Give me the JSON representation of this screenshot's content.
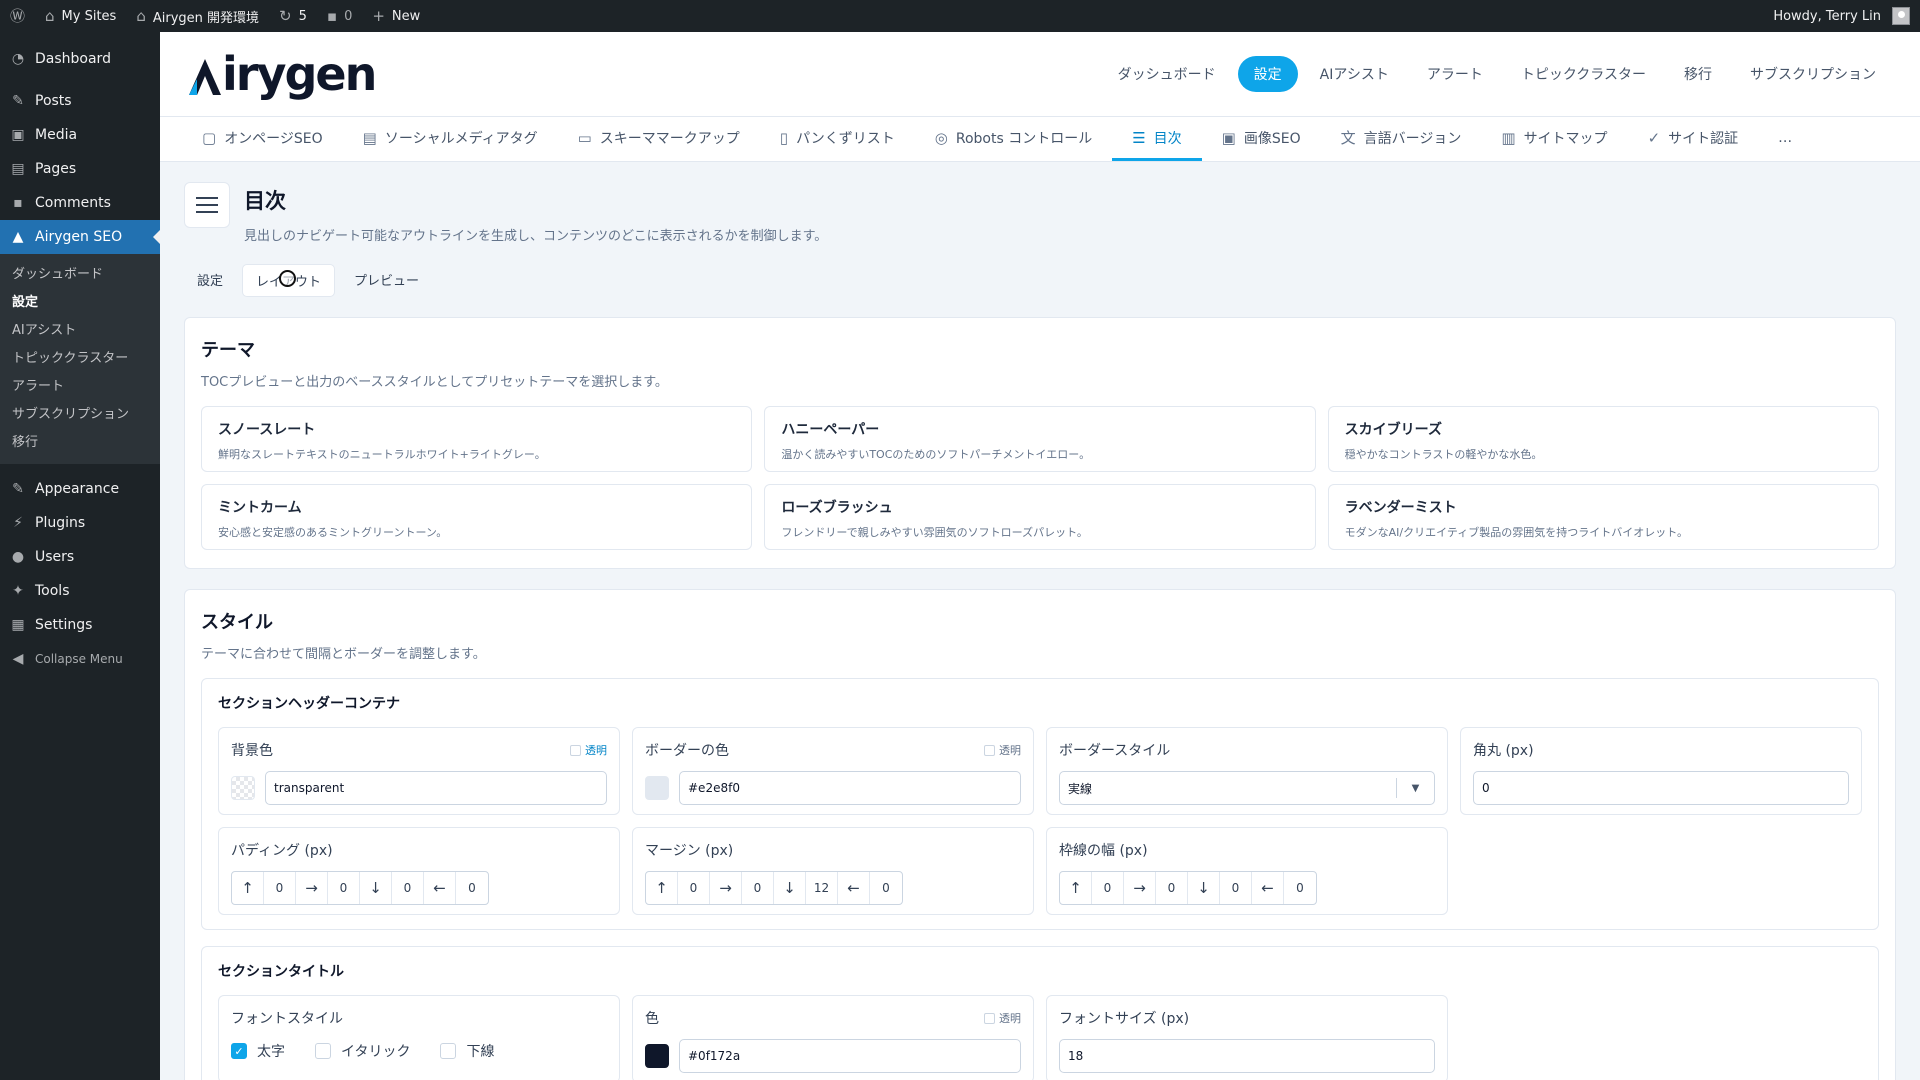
{
  "adminbar": {
    "my_sites": "My Sites",
    "site_name": "Airygen 開発環境",
    "updates_count": "5",
    "comments_count": "0",
    "new_label": "New",
    "howdy": "Howdy, Terry Lin"
  },
  "adminmenu": {
    "dashboard": "Dashboard",
    "posts": "Posts",
    "media": "Media",
    "pages": "Pages",
    "comments": "Comments",
    "airygen": "Airygen SEO",
    "submenu": [
      "ダッシュボード",
      "設定",
      "AIアシスト",
      "トピッククラスター",
      "アラート",
      "サブスクリプション",
      "移行"
    ],
    "appearance": "Appearance",
    "plugins": "Plugins",
    "users": "Users",
    "tools": "Tools",
    "settings": "Settings",
    "collapse": "Collapse Menu"
  },
  "plugin_header": {
    "logo": "irygen",
    "nav": [
      "ダッシュボード",
      "設定",
      "AIアシスト",
      "アラート",
      "トピッククラスター",
      "移行",
      "サブスクリプション"
    ]
  },
  "tabs": [
    "オンページSEO",
    "ソーシャルメディアタグ",
    "スキーママークアップ",
    "パンくずリスト",
    "Robots コントロール",
    "目次",
    "画像SEO",
    "言語バージョン",
    "サイトマップ",
    "サイト認証",
    "…"
  ],
  "page": {
    "title": "目次",
    "desc": "見出しのナビゲート可能なアウトラインを生成し、コンテンツのどこに表示されるかを制御します。",
    "subtabs": [
      "設定",
      "レイアウト",
      "プレビュー"
    ]
  },
  "theme": {
    "title": "テーマ",
    "desc": "TOCプレビューと出力のベーススタイルとしてプリセットテーマを選択します。",
    "items": [
      {
        "name": "スノースレート",
        "desc": "鮮明なスレートテキストのニュートラルホワイト+ライトグレー。"
      },
      {
        "name": "ハニーペーパー",
        "desc": "温かく読みやすいTOCのためのソフトパーチメントイエロー。"
      },
      {
        "name": "スカイブリーズ",
        "desc": "穏やかなコントラストの軽やかな水色。"
      },
      {
        "name": "ミントカーム",
        "desc": "安心感と安定感のあるミントグリーントーン。"
      },
      {
        "name": "ローズブラッシュ",
        "desc": "フレンドリーで親しみやすい雰囲気のソフトローズパレット。"
      },
      {
        "name": "ラベンダーミスト",
        "desc": "モダンなAI/クリエイティブ製品の雰囲気を持つライトバイオレット。"
      }
    ]
  },
  "style": {
    "title": "スタイル",
    "desc": "テーマに合わせて間隔とボーダーを調整します。",
    "header_container": {
      "title": "セクションヘッダーコンテナ",
      "transparent": "透明",
      "bg_label": "背景色",
      "bg_value": "transparent",
      "border_color_label": "ボーダーの色",
      "border_color_value": "#e2e8f0",
      "border_style_label": "ボーダースタイル",
      "border_style_value": "実線",
      "radius_label": "角丸 (px)",
      "radius_value": "0",
      "padding_label": "パディング (px)",
      "padding": [
        "0",
        "0",
        "0",
        "0"
      ],
      "margin_label": "マージン (px)",
      "margin": [
        "0",
        "0",
        "12",
        "0"
      ],
      "border_width_label": "枠線の幅 (px)",
      "border_width": [
        "0",
        "0",
        "0",
        "0"
      ]
    },
    "section_title": {
      "title": "セクションタイトル",
      "font_style_label": "フォントスタイル",
      "bold": "太字",
      "italic": "イタリック",
      "underline": "下線",
      "color_label": "色",
      "transparent": "透明",
      "color_value": "#0f172a",
      "font_size_label": "フォントサイズ (px)",
      "font_size_value": "18"
    }
  },
  "colors": {
    "accent": "#0ea5e9",
    "wp_blue": "#2271b1",
    "wp_dark": "#1d2327"
  }
}
